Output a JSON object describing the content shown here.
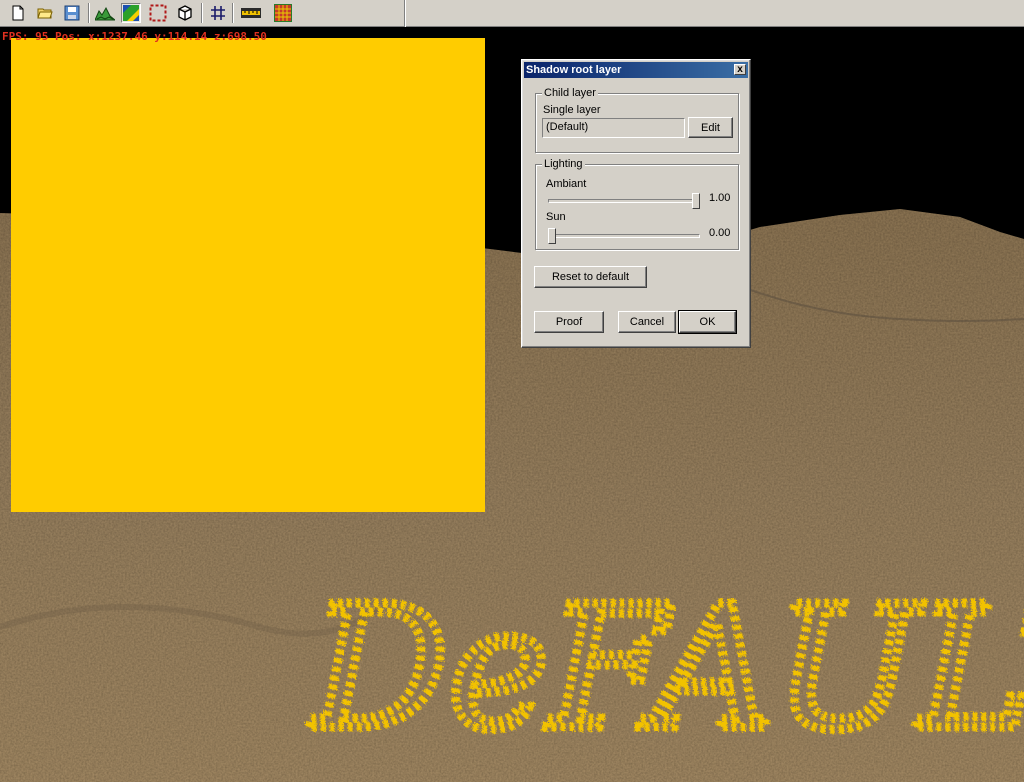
{
  "toolbar": {
    "buttons": [
      {
        "name": "new-document",
        "icon": "new-document-icon"
      },
      {
        "name": "open-folder",
        "icon": "open-folder-icon"
      },
      {
        "name": "save",
        "icon": "save-icon"
      },
      {
        "name": "terrain",
        "icon": "terrain-icon"
      },
      {
        "name": "texture-layer",
        "icon": "texture-layer-icon",
        "pressed": true
      },
      {
        "name": "selection",
        "icon": "selection-icon"
      },
      {
        "name": "cube",
        "icon": "cube-icon"
      },
      {
        "name": "grid",
        "icon": "grid-icon"
      },
      {
        "name": "ruler",
        "icon": "ruler-icon"
      },
      {
        "name": "color-grid",
        "icon": "color-grid-icon"
      }
    ]
  },
  "viewport": {
    "hud": "FPS: 95   Pos: x:1237.46  y:114.14  z:698.50",
    "panel_color": "#ffcc00",
    "terrain_text": "DeFAULT",
    "terrain_text_color": "#f2c200"
  },
  "dialog": {
    "title": "Shadow root layer",
    "close_label": "x",
    "child_layer": {
      "legend": "Child layer",
      "label": "Single layer",
      "value": "(Default)",
      "edit_label": "Edit"
    },
    "lighting": {
      "legend": "Lighting",
      "ambiant_label": "Ambiant",
      "ambiant_value": "1.00",
      "ambiant_level": 1.0,
      "sun_label": "Sun",
      "sun_value": "0.00",
      "sun_level": 0.0
    },
    "reset_label": "Reset to default",
    "proof_label": "Proof",
    "cancel_label": "Cancel",
    "ok_label": "OK"
  }
}
